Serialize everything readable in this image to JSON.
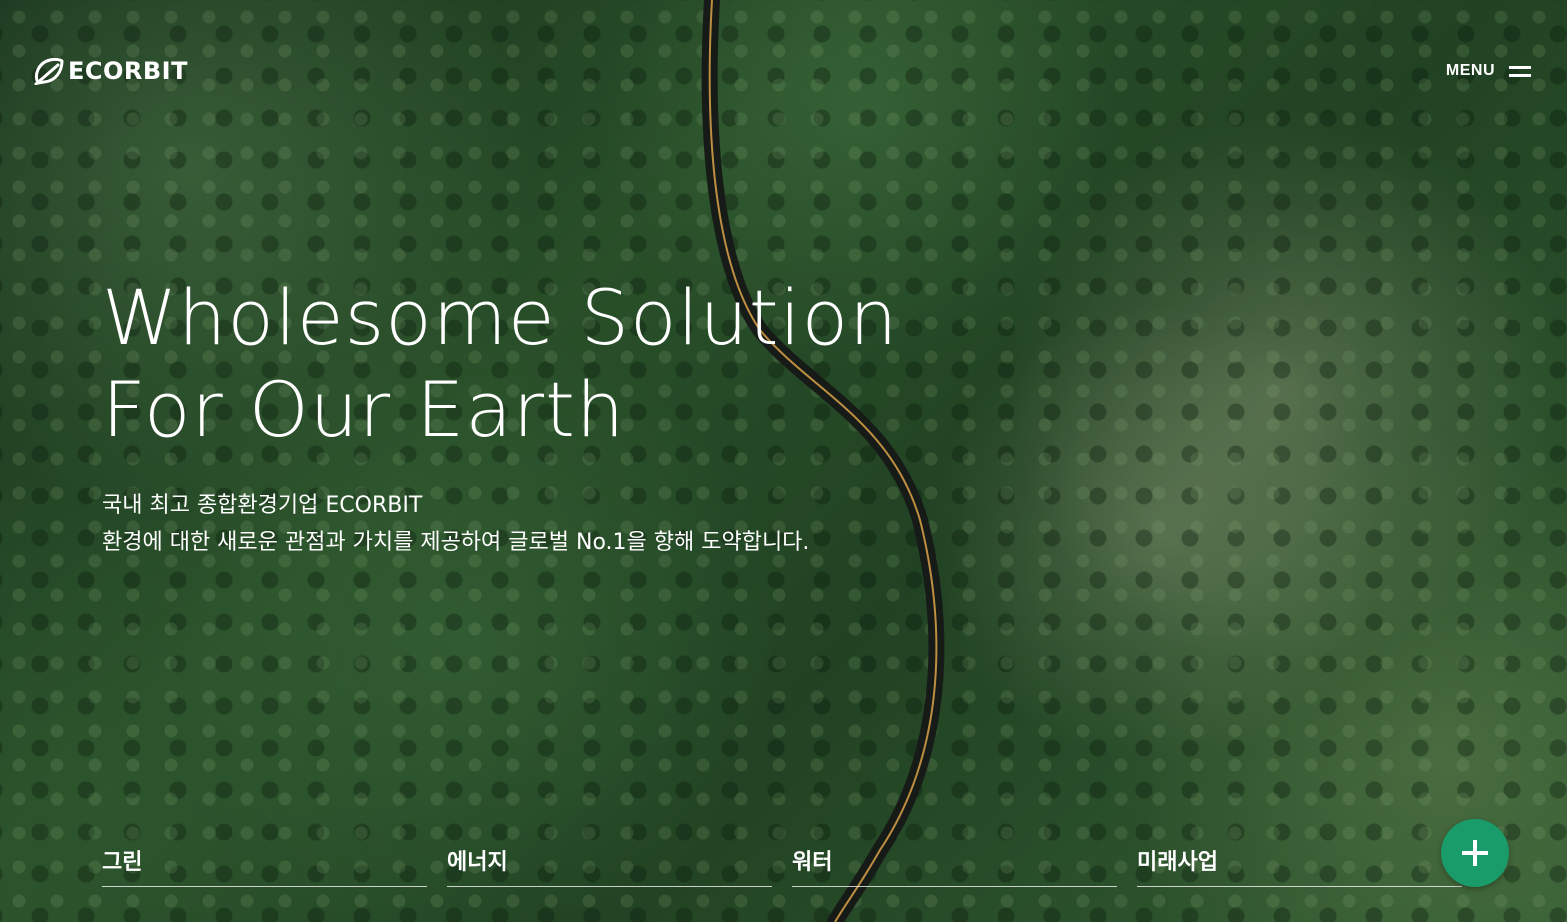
{
  "header": {
    "logo_text": "ECORBIT",
    "menu_label": "MENU"
  },
  "hero": {
    "title_line1": "Wholesome Solution",
    "title_line2": "For Our Earth",
    "desc_line1": "국내 최고 종합환경기업 ECORBIT",
    "desc_line2": "환경에 대한 새로운 관점과 가치를 제공하여 글로벌 No.1을 향해 도약합니다."
  },
  "categories": [
    {
      "label": "그린"
    },
    {
      "label": "에너지"
    },
    {
      "label": "워터"
    },
    {
      "label": "미래사업"
    }
  ],
  "colors": {
    "accent": "#1a9c6a",
    "text": "#ffffff",
    "forest": "#2f5a2f",
    "road_line": "#d9a24a"
  },
  "icons": {
    "logo": "leaf-logo-icon",
    "menu": "hamburger-icon",
    "plus": "plus-icon"
  }
}
